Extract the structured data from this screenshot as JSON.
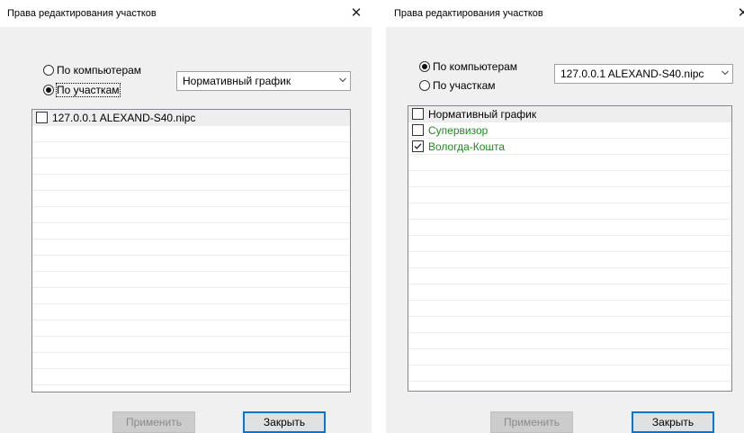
{
  "left": {
    "title": "Права редактирования участков",
    "close": "✕",
    "radio_computers": "По компьютерам",
    "radio_sections": "По участкам",
    "combo_value": "Нормативный график",
    "items": [
      {
        "label": "127.0.0.1 ALEXAND-S40.nipc",
        "checked": false
      }
    ],
    "apply": "Применить",
    "close_btn": "Закрыть"
  },
  "right": {
    "title": "Права редактирования участков",
    "close": "✕",
    "radio_computers": "По компьютерам",
    "radio_sections": "По участкам",
    "combo_value": "127.0.0.1 ALEXAND-S40.nipc",
    "items": [
      {
        "label": "Нормативный график",
        "checked": false
      },
      {
        "label": "Супервизор",
        "checked": false
      },
      {
        "label": "Вологда-Кошта",
        "checked": true
      }
    ],
    "apply": "Применить",
    "close_btn": "Закрыть"
  }
}
